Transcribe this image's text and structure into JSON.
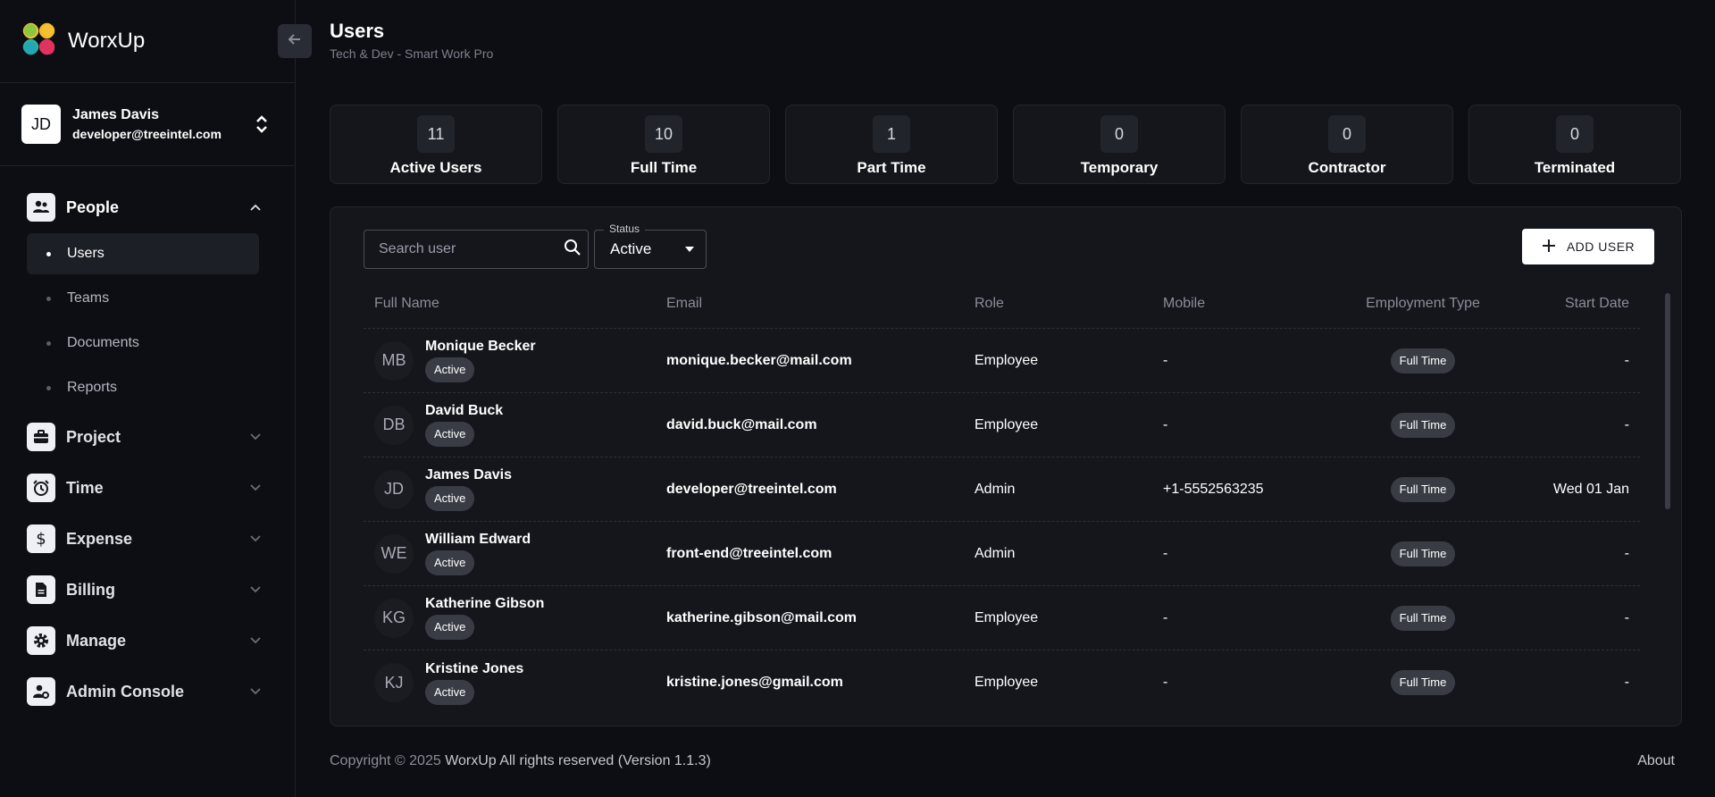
{
  "brand": {
    "name": "WorxUp"
  },
  "user": {
    "initials": "JD",
    "name": "James Davis",
    "email": "developer@treeintel.com"
  },
  "nav": {
    "groups": [
      {
        "label": "People",
        "icon": "people-icon"
      },
      {
        "label": "Project",
        "icon": "briefcase-icon"
      },
      {
        "label": "Time",
        "icon": "alarm-clock-icon"
      },
      {
        "label": "Expense",
        "icon": "dollar-icon"
      },
      {
        "label": "Billing",
        "icon": "document-icon"
      },
      {
        "label": "Manage",
        "icon": "gear-icon"
      },
      {
        "label": "Admin Console",
        "icon": "user-settings-icon"
      }
    ],
    "people_sub": [
      "Users",
      "Teams",
      "Documents",
      "Reports"
    ]
  },
  "header": {
    "title": "Users",
    "subtitle": "Tech & Dev - Smart Work Pro"
  },
  "stats": [
    {
      "value": "11",
      "label": "Active Users"
    },
    {
      "value": "10",
      "label": "Full Time"
    },
    {
      "value": "1",
      "label": "Part Time"
    },
    {
      "value": "0",
      "label": "Temporary"
    },
    {
      "value": "0",
      "label": "Contractor"
    },
    {
      "value": "0",
      "label": "Terminated"
    }
  ],
  "filters": {
    "search_placeholder": "Search user",
    "status_label": "Status",
    "status_value": "Active",
    "add_user_label": "ADD USER"
  },
  "table": {
    "columns": [
      "Full Name",
      "Email",
      "Role",
      "Mobile",
      "Employment Type",
      "Start Date"
    ],
    "rows": [
      {
        "initials": "MB",
        "name": "Monique Becker",
        "status": "Active",
        "email": "monique.becker@mail.com",
        "role": "Employee",
        "mobile": "-",
        "type": "Full Time",
        "start": "-"
      },
      {
        "initials": "DB",
        "name": "David Buck",
        "status": "Active",
        "email": "david.buck@mail.com",
        "role": "Employee",
        "mobile": "-",
        "type": "Full Time",
        "start": "-"
      },
      {
        "initials": "JD",
        "name": "James Davis",
        "status": "Active",
        "email": "developer@treeintel.com",
        "role": "Admin",
        "mobile": "+1-5552563235",
        "type": "Full Time",
        "start": "Wed 01 Jan"
      },
      {
        "initials": "WE",
        "name": "William Edward",
        "status": "Active",
        "email": "front-end@treeintel.com",
        "role": "Admin",
        "mobile": "-",
        "type": "Full Time",
        "start": "-"
      },
      {
        "initials": "KG",
        "name": "Katherine Gibson",
        "status": "Active",
        "email": "katherine.gibson@mail.com",
        "role": "Employee",
        "mobile": "-",
        "type": "Full Time",
        "start": "-"
      },
      {
        "initials": "KJ",
        "name": "Kristine Jones",
        "status": "Active",
        "email": "kristine.jones@gmail.com",
        "role": "Employee",
        "mobile": "-",
        "type": "Full Time",
        "start": "-"
      }
    ]
  },
  "footer": {
    "copyright": "Copyright © 2025",
    "brand_text": "WorxUp All rights reserved",
    "version": "(Version 1.1.3)",
    "about": "About"
  }
}
